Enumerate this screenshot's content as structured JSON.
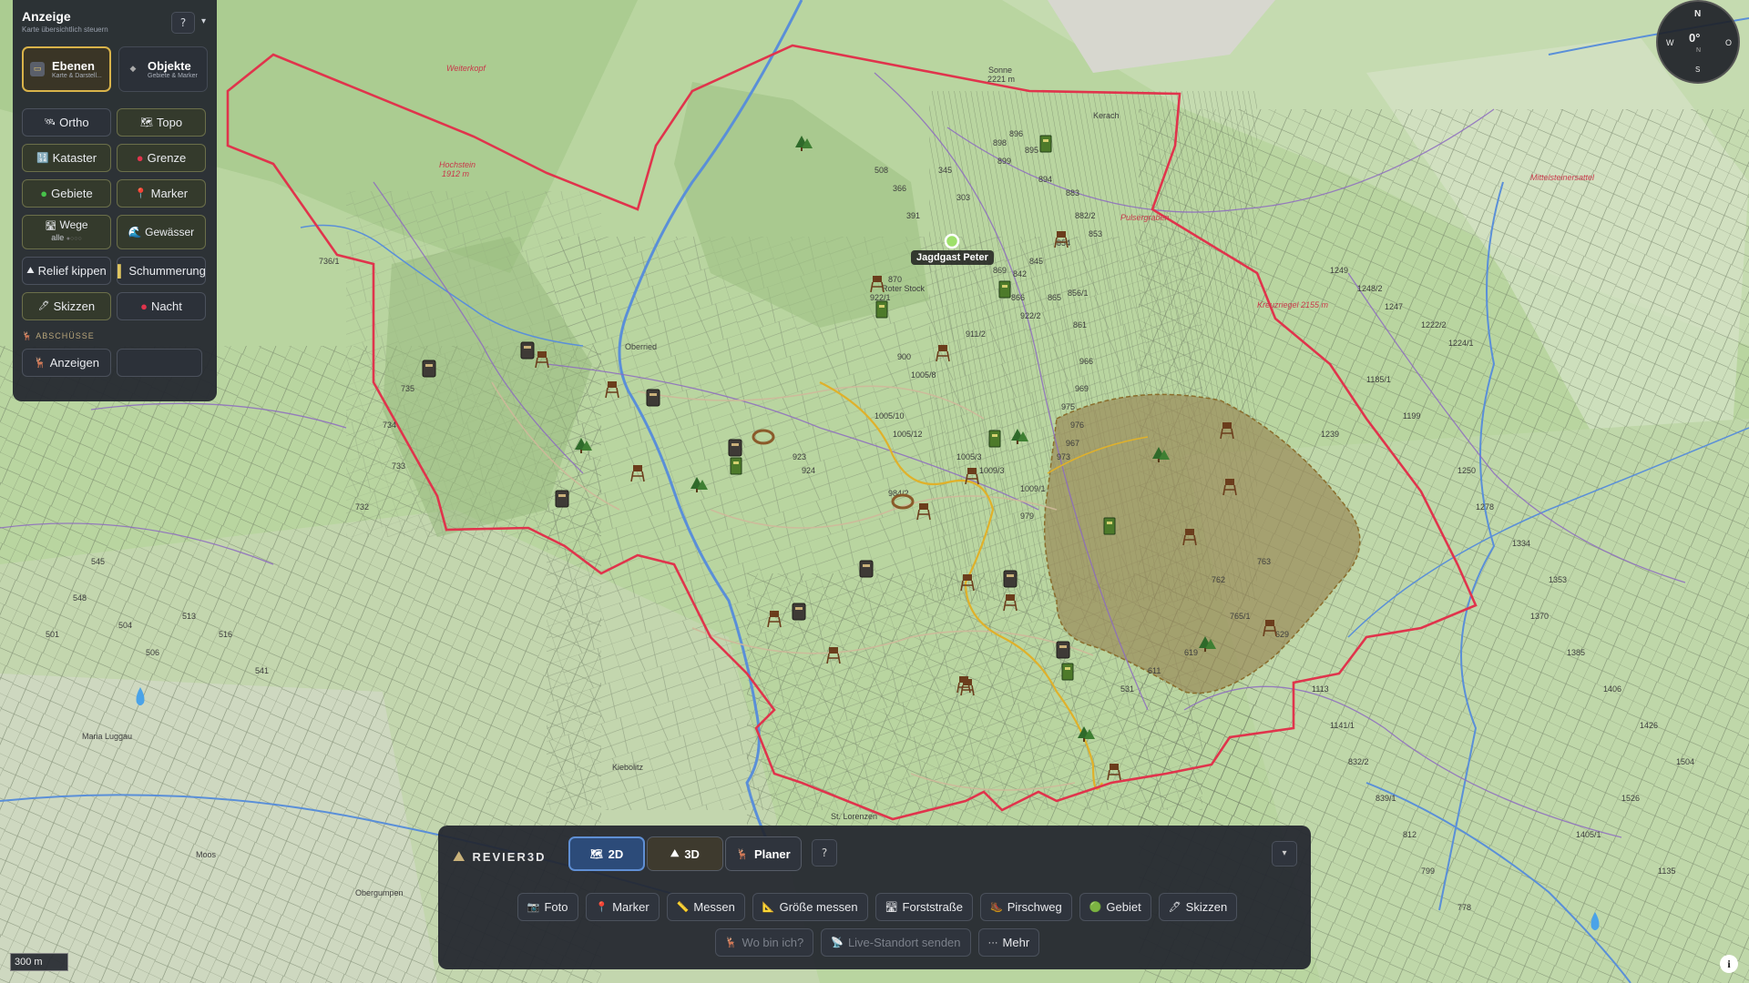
{
  "map": {
    "user_marker_label": "Jagdgast Peter",
    "scale_label": "300 m",
    "place_labels": [
      "Sonne 2221 m",
      "Kerach",
      "Hochstein 1912 m",
      "Pulsergraben",
      "Weiterkopf",
      "Roter Stock",
      "Oberried",
      "Kiebolitz",
      "Maria Luggau",
      "Moos",
      "Obergumpen",
      "St. Lorenzen",
      "Kreuzriegel 2155 m",
      "Mittelsteinersattel"
    ],
    "parcel_labels": [
      "898",
      "899",
      "896",
      "895",
      "894",
      "883",
      "882/2",
      "853",
      "854",
      "845",
      "842",
      "866",
      "865",
      "861",
      "856/1",
      "869",
      "870",
      "922/1",
      "922/2",
      "911/2",
      "900",
      "1005/8",
      "1005/10",
      "1005/12",
      "1005/3",
      "1009/3",
      "1009/1",
      "979",
      "984/2",
      "923",
      "924",
      "966",
      "969",
      "975",
      "976",
      "967",
      "973",
      "736/1",
      "735",
      "734",
      "733",
      "732",
      "545",
      "548",
      "501",
      "504",
      "506",
      "513",
      "516",
      "541",
      "1249",
      "1248/2",
      "1247",
      "1222/2",
      "1224/1",
      "1185/1",
      "1199",
      "1239",
      "1250",
      "1278",
      "1334",
      "1353",
      "1370",
      "1385",
      "1406",
      "1426",
      "1504",
      "1526",
      "1405/1",
      "1135",
      "1113",
      "1141/1",
      "832/2",
      "839/1",
      "812",
      "799",
      "778",
      "763",
      "762",
      "765/1",
      "629",
      "619",
      "611",
      "531",
      "508",
      "366",
      "391",
      "345",
      "303"
    ]
  },
  "left_panel": {
    "title": "Anzeige",
    "subtitle": "Karte übersichtlich steuern",
    "help": "?",
    "caret": "▾",
    "tabs": [
      {
        "label": "Ebenen",
        "sub": "Karte & Darstell...",
        "icon": "layers-icon"
      },
      {
        "label": "Objekte",
        "sub": "Gebiete & Marker",
        "icon": "objects-icon"
      }
    ],
    "buttons": {
      "ortho": "Ortho",
      "topo": "Topo",
      "kataster": "Kataster",
      "grenze": "Grenze",
      "gebiete": "Gebiete",
      "marker": "Marker",
      "wege": "Wege",
      "wege_sub": "alle",
      "gewaesser": "Gewässer",
      "relief": "Relief kippen",
      "schummerung": "Schummerung",
      "skizzen": "Skizzen",
      "nacht": "Nacht"
    },
    "section_abschuesse": "ABSCHÜSSE",
    "anzeigen": "Anzeigen"
  },
  "compass": {
    "n": "N",
    "s": "S",
    "w": "W",
    "o": "O",
    "degrees": "0°",
    "n_small": "N"
  },
  "toolbar": {
    "brand": "REVIER3D",
    "mode_2d": "2D",
    "mode_3d": "3D",
    "planer": "Planer",
    "help": "?",
    "caret": "▾",
    "tools": [
      {
        "label": "Foto",
        "icon": "📷",
        "disabled": false
      },
      {
        "label": "Marker",
        "icon": "📍",
        "disabled": false
      },
      {
        "label": "Messen",
        "icon": "📏",
        "disabled": false
      },
      {
        "label": "Größe messen",
        "icon": "📐",
        "disabled": false
      },
      {
        "label": "Forststraße",
        "icon": "🛣",
        "disabled": false
      },
      {
        "label": "Pirschweg",
        "icon": "🥾",
        "disabled": false
      },
      {
        "label": "Gebiet",
        "icon": "🟢",
        "disabled": false
      },
      {
        "label": "Skizzen",
        "icon": "🖊",
        "disabled": false
      },
      {
        "label": "Wo bin ich?",
        "icon": "🦌",
        "disabled": true
      },
      {
        "label": "Live-Standort senden",
        "icon": "📡",
        "disabled": true
      },
      {
        "label": "Mehr",
        "icon": "···",
        "disabled": false
      }
    ]
  },
  "colors": {
    "boundary": "#e0344c",
    "area_fill": "#9a8a58",
    "path": "#e0b12a",
    "river": "#5a8fd8",
    "panel_bg": "#22262e",
    "active_blue": "#2c4b79",
    "gold": "#d9b34a"
  }
}
